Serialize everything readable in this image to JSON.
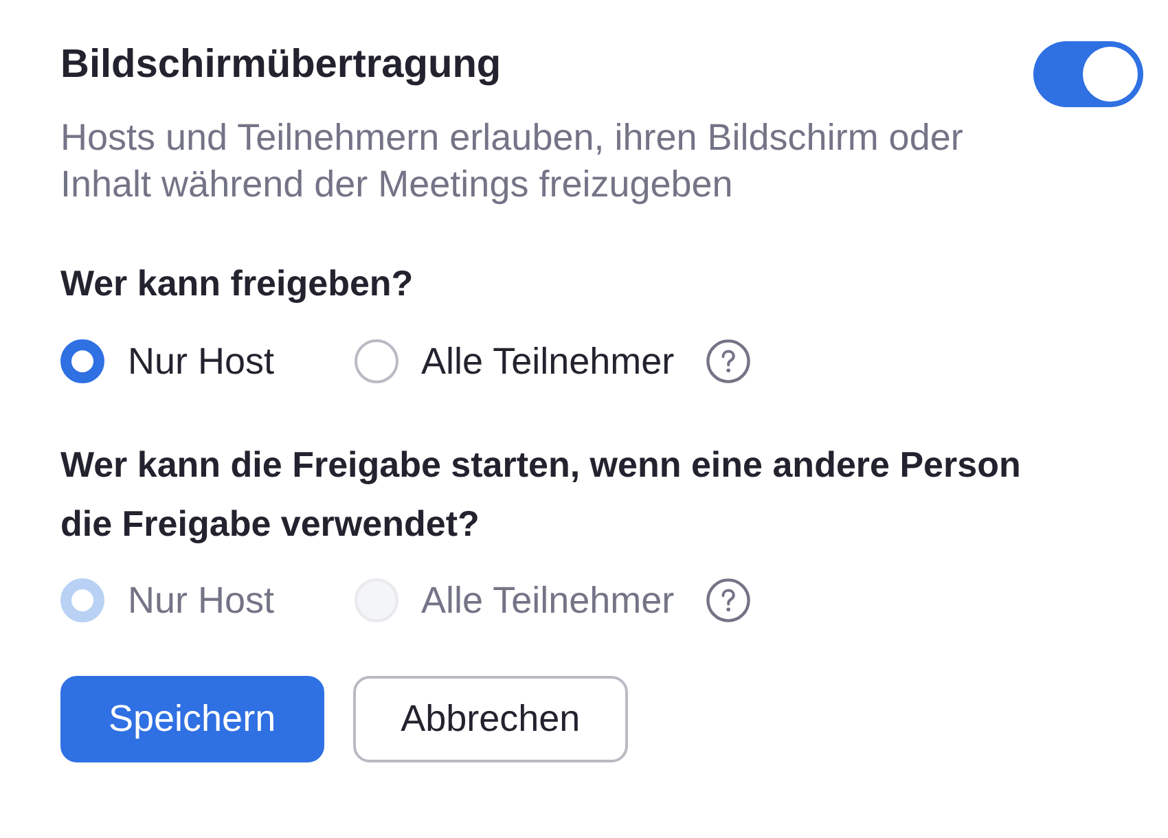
{
  "setting": {
    "title": "Bildschirmübertragung",
    "on": true,
    "description": "Hosts und Teilnehmern erlauben, ihren Bildschirm oder Inhalt während der Meetings freizugeben"
  },
  "questions": [
    {
      "label": "Wer kann freigeben?",
      "disabled": false,
      "options": [
        {
          "label": "Nur Host",
          "selected": true
        },
        {
          "label": "Alle Teilnehmer",
          "selected": false
        }
      ]
    },
    {
      "label": "Wer kann die Freigabe starten, wenn eine andere Person die Freigabe verwendet?",
      "disabled": true,
      "options": [
        {
          "label": "Nur Host",
          "selected": true
        },
        {
          "label": "Alle Teilnehmer",
          "selected": false
        }
      ]
    }
  ],
  "buttons": [
    {
      "label": "Speichern",
      "kind": "primary"
    },
    {
      "label": "Abbrechen",
      "kind": "secondary"
    }
  ]
}
